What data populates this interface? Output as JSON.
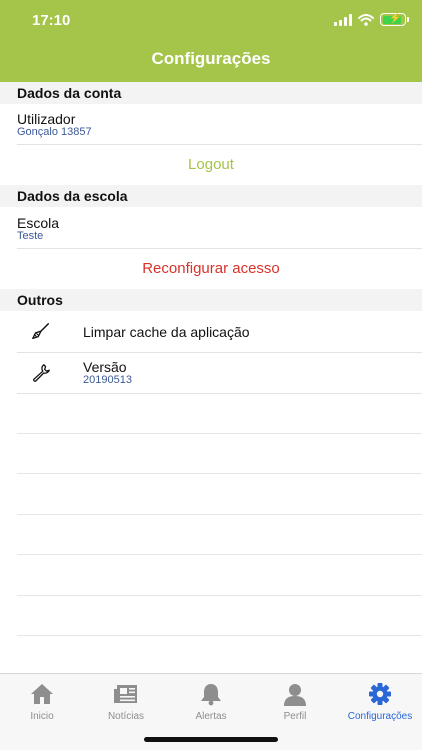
{
  "status_bar": {
    "time": "17:10"
  },
  "header": {
    "title": "Configurações"
  },
  "account": {
    "section_title": "Dados da conta",
    "user_label": "Utilizador",
    "user_value": "Gonçalo 13857",
    "logout_label": "Logout"
  },
  "school": {
    "section_title": "Dados da escola",
    "school_label": "Escola",
    "school_value": "Teste",
    "reconfigure_label": "Reconfigurar acesso"
  },
  "others": {
    "section_title": "Outros",
    "clear_cache_label": "Limpar cache da aplicação",
    "version_label": "Versão",
    "version_value": "20190513"
  },
  "tabbar": {
    "tabs": [
      {
        "label": "Inicio",
        "icon": "home-icon"
      },
      {
        "label": "Notícias",
        "icon": "newspaper-icon"
      },
      {
        "label": "Alertas",
        "icon": "bell-icon"
      },
      {
        "label": "Perfil",
        "icon": "person-icon"
      },
      {
        "label": "Configurações",
        "icon": "gear-icon"
      }
    ],
    "active_index": 4
  },
  "colors": {
    "accent": "#a5c44a",
    "danger": "#d9322b",
    "link": "#3c5a99",
    "active_tab": "#2a66d6",
    "inactive_tab": "#8e8e8e"
  }
}
